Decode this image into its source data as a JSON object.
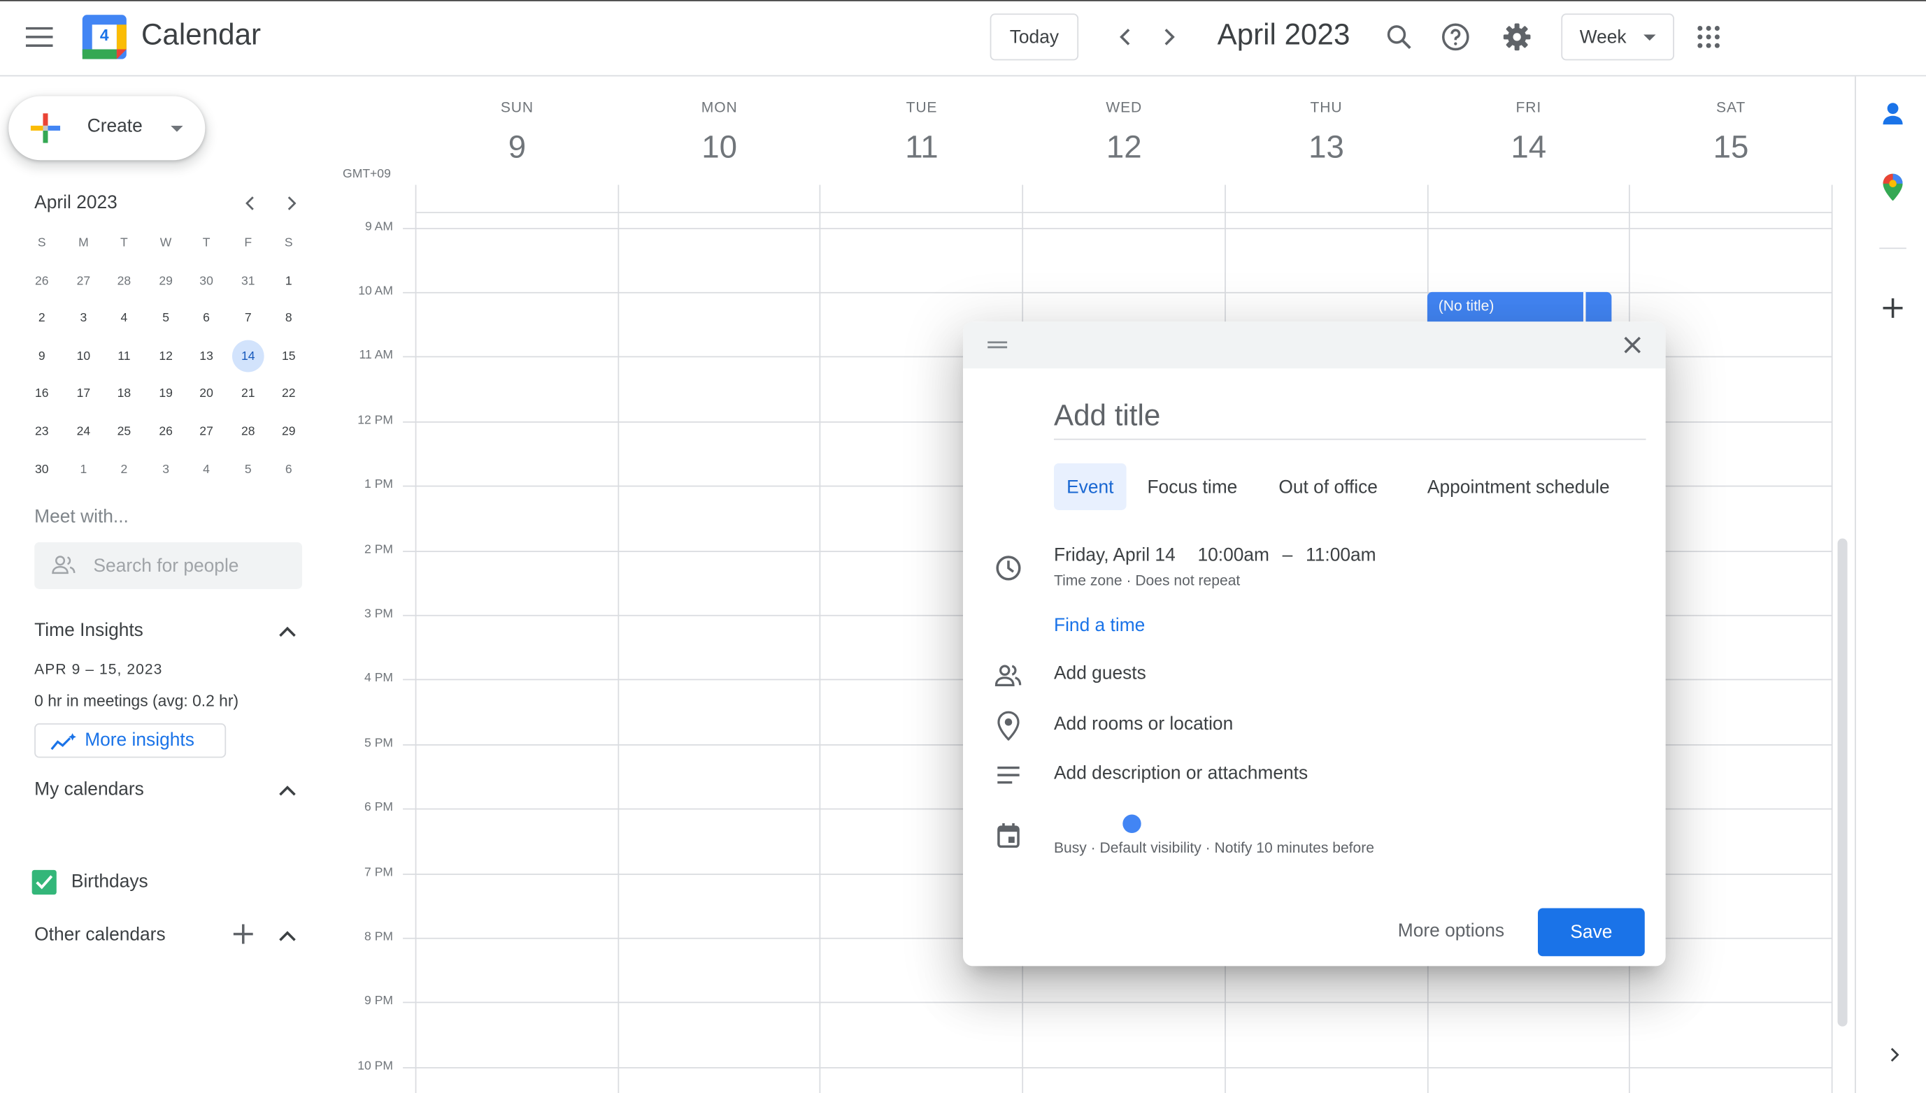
{
  "header": {
    "app_title": "Calendar",
    "logo_day": "4",
    "today_label": "Today",
    "period_title": "April 2023",
    "view_label": "Week"
  },
  "sidebar": {
    "create_label": "Create",
    "mini_cal": {
      "title": "April 2023",
      "weekday_heads": [
        "S",
        "M",
        "T",
        "W",
        "T",
        "F",
        "S"
      ],
      "weeks": [
        [
          "26",
          "27",
          "28",
          "29",
          "30",
          "31",
          "1"
        ],
        [
          "2",
          "3",
          "4",
          "5",
          "6",
          "7",
          "8"
        ],
        [
          "9",
          "10",
          "11",
          "12",
          "13",
          "14",
          "15"
        ],
        [
          "16",
          "17",
          "18",
          "19",
          "20",
          "21",
          "22"
        ],
        [
          "23",
          "24",
          "25",
          "26",
          "27",
          "28",
          "29"
        ],
        [
          "30",
          "1",
          "2",
          "3",
          "4",
          "5",
          "6"
        ]
      ]
    },
    "meet_with": "Meet with...",
    "search_people_placeholder": "Search for people",
    "time_insights": {
      "heading": "Time Insights",
      "range": "APR 9 – 15, 2023",
      "summary": "0 hr in meetings (avg: 0.2 hr)",
      "more_label": "More insights"
    },
    "my_calendars": {
      "heading": "My calendars",
      "items": [
        {
          "label": "Birthdays",
          "checked": true,
          "color": "#33b679"
        }
      ]
    },
    "other_calendars_heading": "Other calendars"
  },
  "grid": {
    "timezone": "GMT+09",
    "days": [
      {
        "name": "SUN",
        "num": "9"
      },
      {
        "name": "MON",
        "num": "10"
      },
      {
        "name": "TUE",
        "num": "11"
      },
      {
        "name": "WED",
        "num": "12"
      },
      {
        "name": "THU",
        "num": "13"
      },
      {
        "name": "FRI",
        "num": "14"
      },
      {
        "name": "SAT",
        "num": "15"
      }
    ],
    "hours": [
      "9 AM",
      "10 AM",
      "11 AM",
      "12 PM",
      "1 PM",
      "2 PM",
      "3 PM",
      "4 PM",
      "5 PM",
      "6 PM",
      "7 PM",
      "8 PM",
      "9 PM",
      "10 PM"
    ],
    "event_label": "(No title)"
  },
  "dialog": {
    "title_placeholder": "Add title",
    "tabs": [
      "Event",
      "Focus time",
      "Out of office",
      "Appointment schedule"
    ],
    "date": "Friday, April 14",
    "start": "10:00am",
    "dash": "–",
    "end": "11:00am",
    "time_sub": "Time zone · Does not repeat",
    "find_time": "Find a time",
    "add_guests": "Add guests",
    "add_location": "Add rooms or location",
    "add_description": "Add description or attachments",
    "calendar_sub": "Busy · Default visibility · Notify 10 minutes before",
    "more_options": "More options",
    "save": "Save"
  },
  "colors": {
    "accent": "#1a73e8",
    "event": "#4285f4",
    "selected_day": "#d2e3fc"
  }
}
